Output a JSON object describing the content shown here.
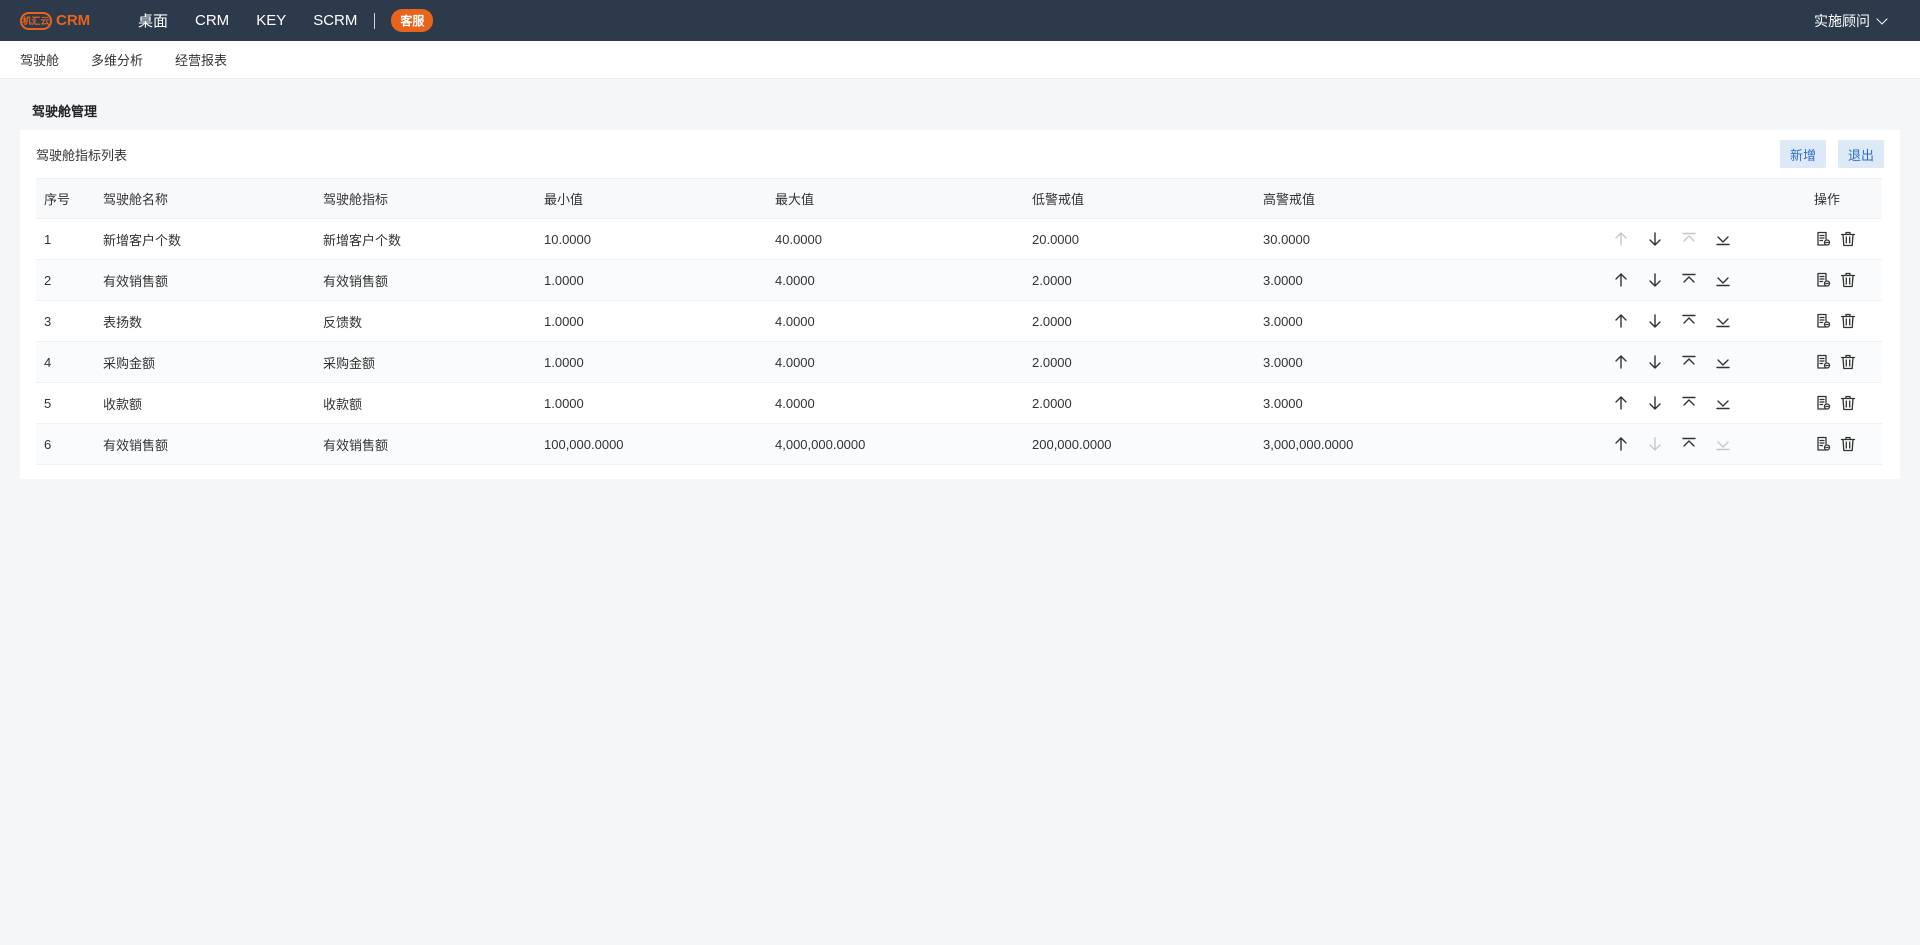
{
  "brand": {
    "logo_mark": "机汇云",
    "logo_text": "CRM",
    "accent": "#e8641b"
  },
  "top_nav": {
    "items": [
      "桌面",
      "CRM",
      "KEY",
      "SCRM"
    ],
    "service_badge": "客服",
    "user_role": "实施顾问"
  },
  "sub_nav": {
    "items": [
      "驾驶舱",
      "多维分析",
      "经营报表"
    ]
  },
  "page": {
    "title": "驾驶舱管理"
  },
  "card": {
    "title": "驾驶舱指标列表",
    "add_label": "新增",
    "exit_label": "退出"
  },
  "table": {
    "headers": [
      "序号",
      "驾驶舱名称",
      "驾驶舱指标",
      "最小值",
      "最大值",
      "低警戒值",
      "高警戒值",
      "",
      "操作"
    ],
    "rows": [
      {
        "no": "1",
        "name": "新增客户个数",
        "indicator": "新增客户个数",
        "min": "10.0000",
        "max": "40.0000",
        "low": "20.0000",
        "high": "30.0000",
        "up_disabled": true,
        "down_disabled": false,
        "top_disabled": true,
        "bottom_disabled": false
      },
      {
        "no": "2",
        "name": "有效销售额",
        "indicator": "有效销售额",
        "min": "1.0000",
        "max": "4.0000",
        "low": "2.0000",
        "high": "3.0000",
        "up_disabled": false,
        "down_disabled": false,
        "top_disabled": false,
        "bottom_disabled": false
      },
      {
        "no": "3",
        "name": "表扬数",
        "indicator": "反馈数",
        "min": "1.0000",
        "max": "4.0000",
        "low": "2.0000",
        "high": "3.0000",
        "up_disabled": false,
        "down_disabled": false,
        "top_disabled": false,
        "bottom_disabled": false
      },
      {
        "no": "4",
        "name": "采购金额",
        "indicator": "采购金额",
        "min": "1.0000",
        "max": "4.0000",
        "low": "2.0000",
        "high": "3.0000",
        "up_disabled": false,
        "down_disabled": false,
        "top_disabled": false,
        "bottom_disabled": false
      },
      {
        "no": "5",
        "name": "收款额",
        "indicator": "收款额",
        "min": "1.0000",
        "max": "4.0000",
        "low": "2.0000",
        "high": "3.0000",
        "up_disabled": false,
        "down_disabled": false,
        "top_disabled": false,
        "bottom_disabled": false
      },
      {
        "no": "6",
        "name": "有效销售额",
        "indicator": "有效销售额",
        "min": "100,000.0000",
        "max": "4,000,000.0000",
        "low": "200,000.0000",
        "high": "3,000,000.0000",
        "up_disabled": false,
        "down_disabled": true,
        "top_disabled": false,
        "bottom_disabled": true
      }
    ]
  },
  "icons": {
    "move_up": "arrow-up-icon",
    "move_down": "arrow-down-icon",
    "move_top": "move-top-icon",
    "move_bottom": "move-bottom-icon",
    "edit": "edit-document-icon",
    "delete": "trash-icon"
  }
}
